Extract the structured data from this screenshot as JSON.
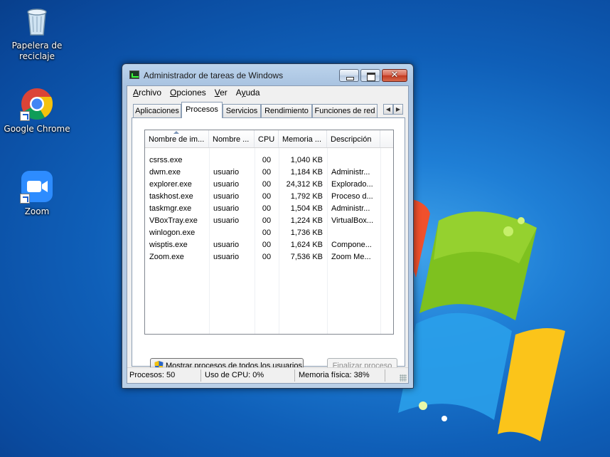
{
  "desktop": {
    "icons": [
      {
        "label": "Papelera de reciclaje"
      },
      {
        "label": "Google Chrome"
      },
      {
        "label": "Zoom"
      }
    ]
  },
  "window": {
    "title": "Administrador de tareas de Windows",
    "menu": [
      {
        "label": "Archivo",
        "accel": "A"
      },
      {
        "label": "Opciones",
        "accel": "O"
      },
      {
        "label": "Ver",
        "accel": "V"
      },
      {
        "label": "Ayuda",
        "accel": "y"
      }
    ],
    "tabs": [
      "Aplicaciones",
      "Procesos",
      "Servicios",
      "Rendimiento",
      "Funciones de red"
    ],
    "active_tab": "Procesos",
    "columns": [
      "Nombre de im...",
      "Nombre ...",
      "CPU",
      "Memoria ...",
      "Descripción"
    ],
    "processes": [
      {
        "name": "csrss.exe",
        "user": "",
        "cpu": "00",
        "mem": "1,040 KB",
        "desc": ""
      },
      {
        "name": "dwm.exe",
        "user": "usuario",
        "cpu": "00",
        "mem": "1,184 KB",
        "desc": "Administr..."
      },
      {
        "name": "explorer.exe",
        "user": "usuario",
        "cpu": "00",
        "mem": "24,312 KB",
        "desc": "Explorado..."
      },
      {
        "name": "taskhost.exe",
        "user": "usuario",
        "cpu": "00",
        "mem": "1,792 KB",
        "desc": "Proceso d..."
      },
      {
        "name": "taskmgr.exe",
        "user": "usuario",
        "cpu": "00",
        "mem": "1,504 KB",
        "desc": "Administr..."
      },
      {
        "name": "VBoxTray.exe",
        "user": "usuario",
        "cpu": "00",
        "mem": "1,224 KB",
        "desc": "VirtualBox..."
      },
      {
        "name": "winlogon.exe",
        "user": "",
        "cpu": "00",
        "mem": "1,736 KB",
        "desc": ""
      },
      {
        "name": "wisptis.exe",
        "user": "usuario",
        "cpu": "00",
        "mem": "1,624 KB",
        "desc": "Compone..."
      },
      {
        "name": "Zoom.exe",
        "user": "usuario",
        "cpu": "00",
        "mem": "7,536 KB",
        "desc": "Zoom Me..."
      }
    ],
    "buttons": {
      "show_all": "Mostrar procesos de todos los usuarios",
      "end_process": "Finalizar proceso"
    },
    "status": {
      "processes": "Procesos: 50",
      "cpu": "Uso de CPU: 0%",
      "memory": "Memoria física: 38%"
    }
  }
}
